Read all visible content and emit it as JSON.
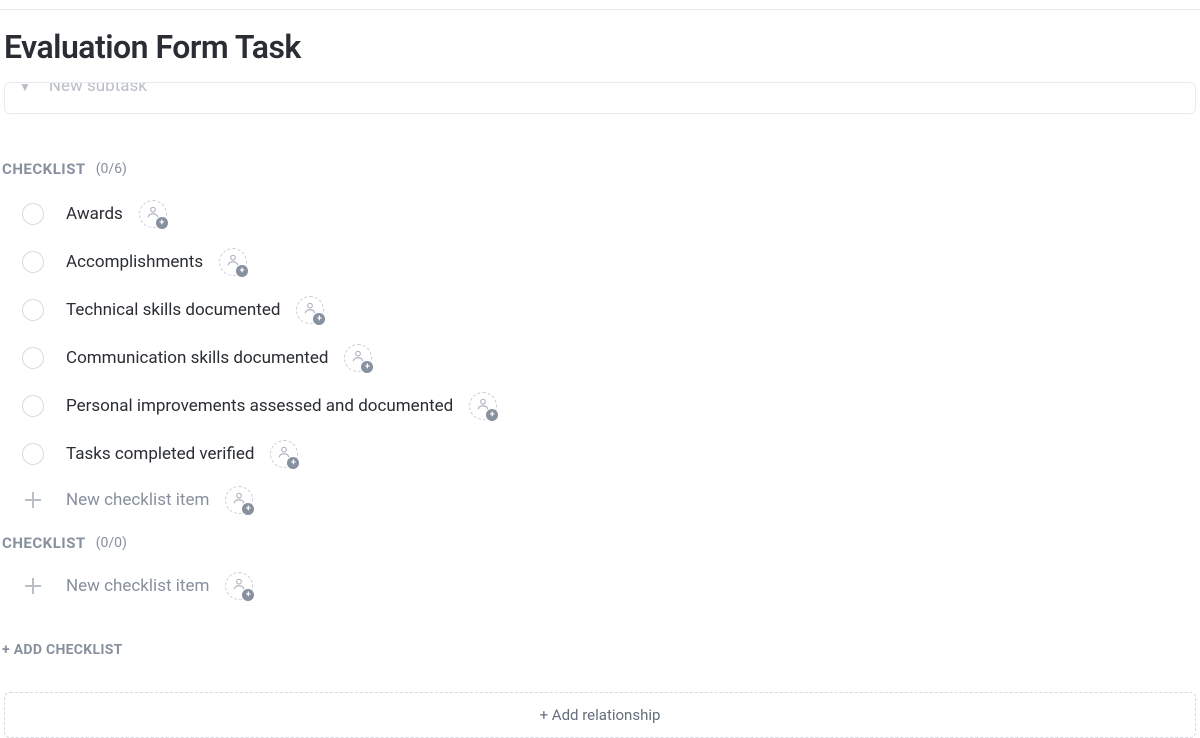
{
  "page_title": "Evaluation Form Task",
  "subtask_placeholder": "New subtask",
  "checklists": [
    {
      "label": "CHECKLIST",
      "count": "(0/6)",
      "items": [
        {
          "label": "Awards"
        },
        {
          "label": "Accomplishments"
        },
        {
          "label": "Technical skills documented"
        },
        {
          "label": "Communication skills documented"
        },
        {
          "label": "Personal improvements assessed and documented"
        },
        {
          "label": "Tasks completed verified"
        }
      ],
      "new_item_placeholder": "New checklist item"
    },
    {
      "label": "CHECKLIST",
      "count": "(0/0)",
      "items": [],
      "new_item_placeholder": "New checklist item"
    }
  ],
  "add_checklist_label": "+ ADD CHECKLIST",
  "add_relationship_label": "+ Add relationship"
}
